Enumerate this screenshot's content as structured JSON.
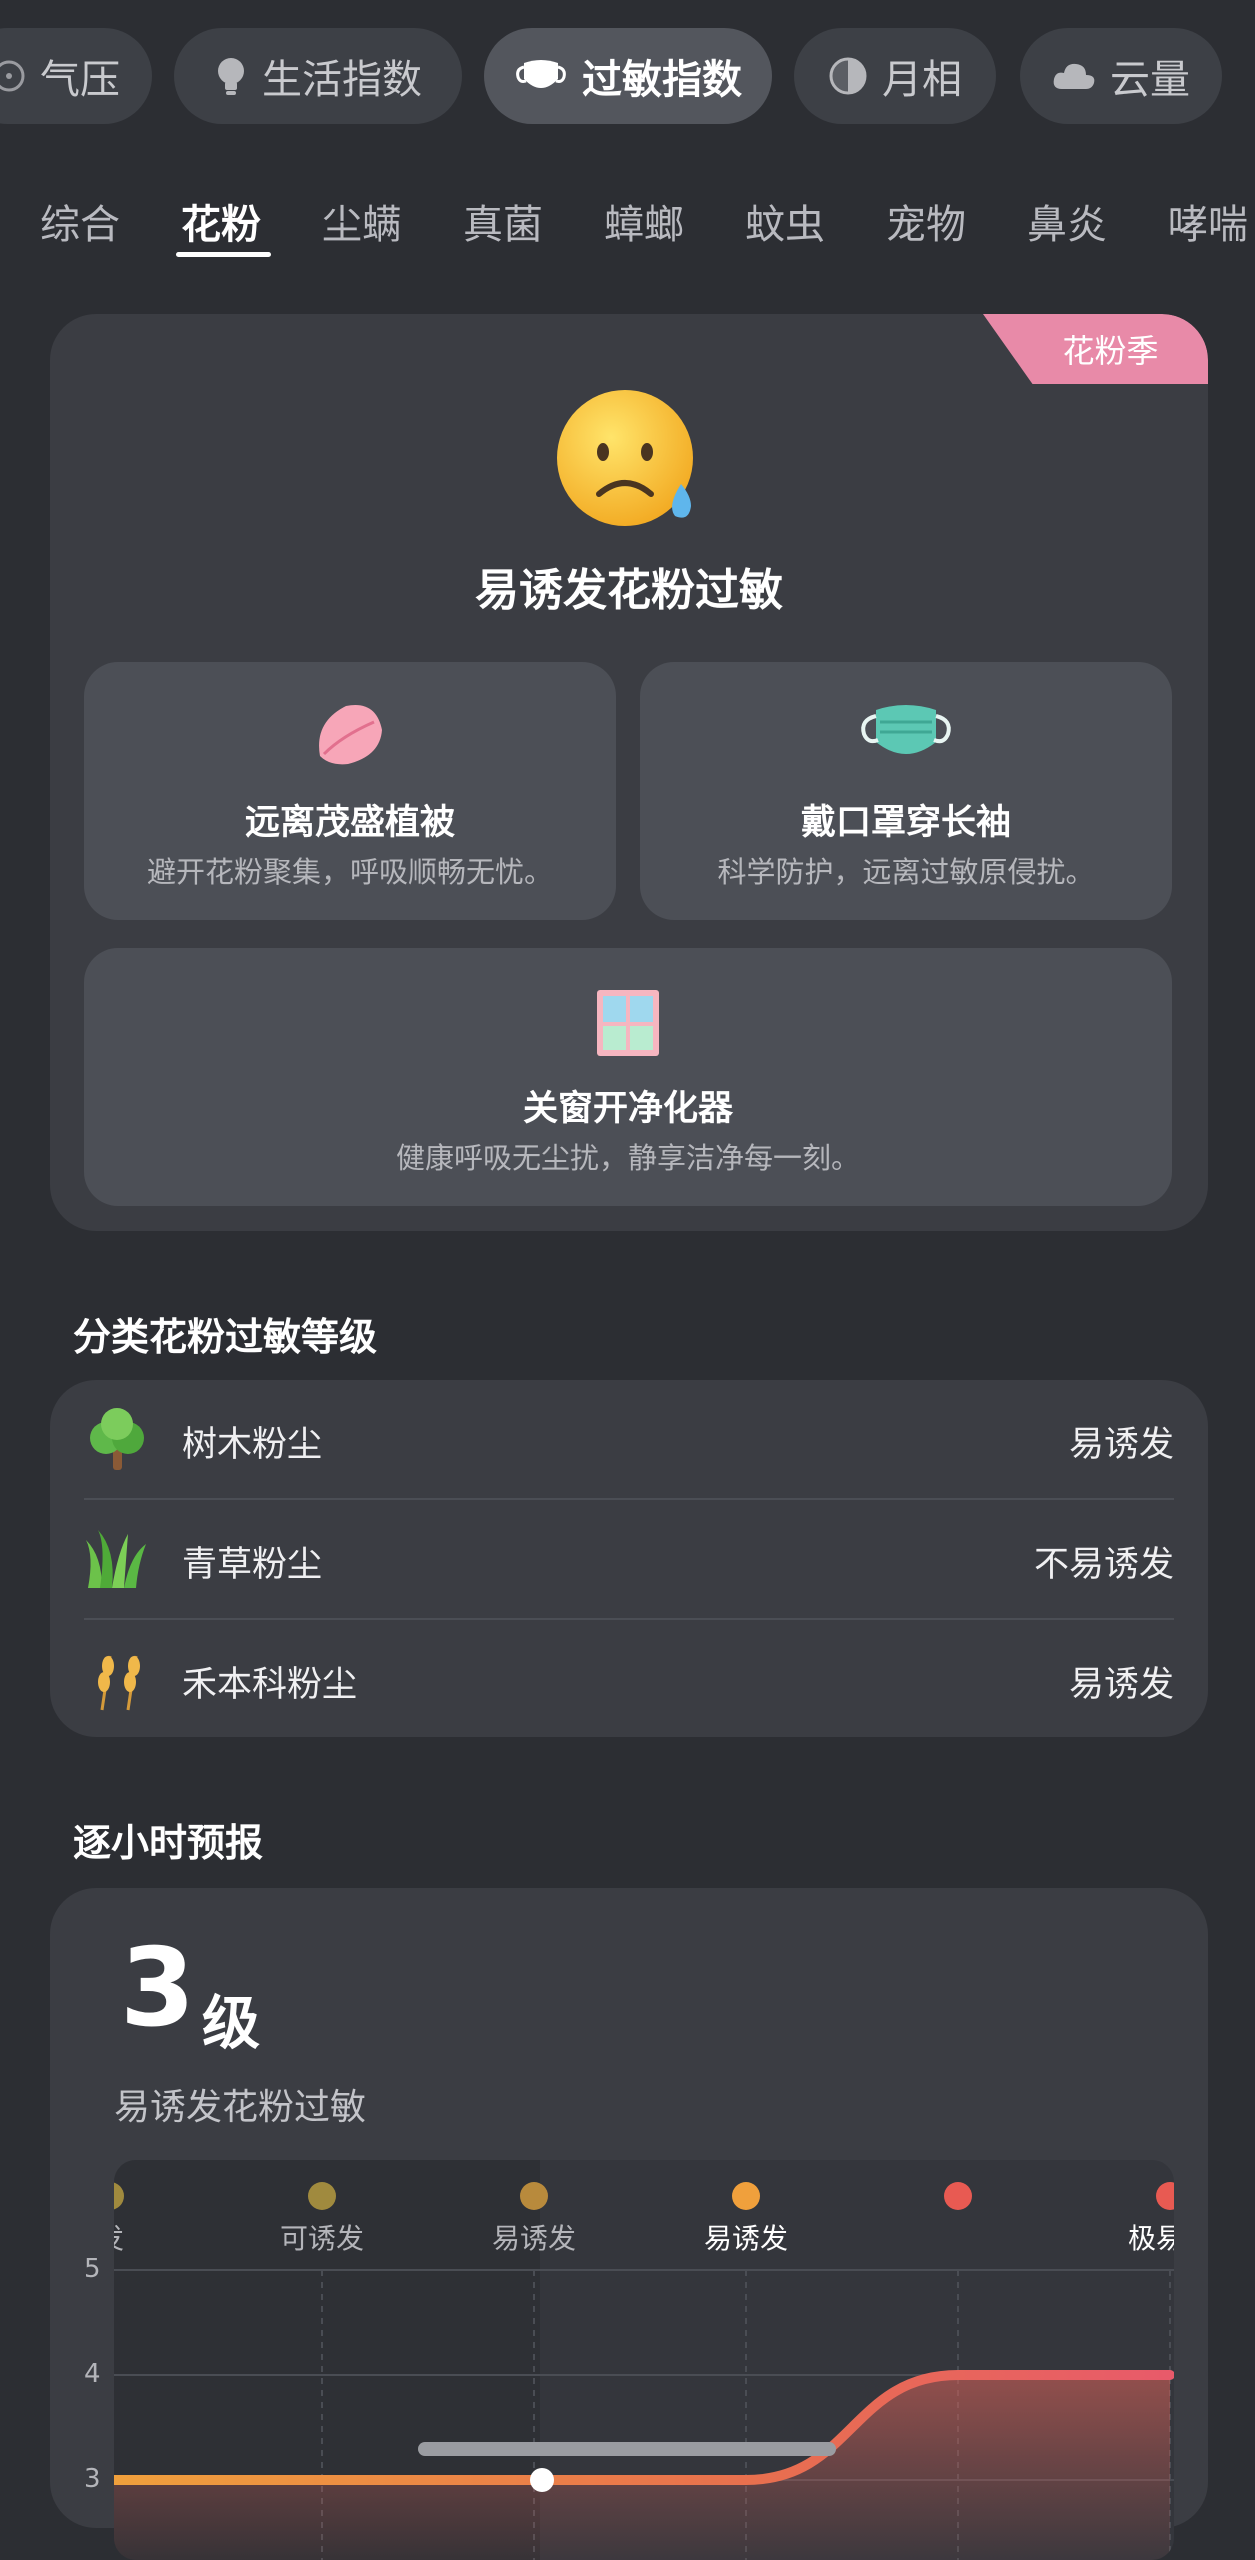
{
  "top_tabs": [
    {
      "label": "气压",
      "icon": "gauge-icon"
    },
    {
      "label": "生活指数",
      "icon": "lightbulb-icon"
    },
    {
      "label": "过敏指数",
      "icon": "mask-icon",
      "active": true
    },
    {
      "label": "月相",
      "icon": "moon-icon"
    },
    {
      "label": "云量",
      "icon": "cloud-icon"
    }
  ],
  "sub_tabs": [
    "综合",
    "花粉",
    "尘螨",
    "真菌",
    "蟑螂",
    "蚊虫",
    "宠物",
    "鼻炎",
    "哮喘"
  ],
  "active_sub_tab": "花粉",
  "hero": {
    "season_tag": "花粉季",
    "face_icon": "sad-face-tear-icon",
    "title": "易诱发花粉过敏",
    "tips": [
      {
        "title": "远离茂盛植被",
        "desc": "避开花粉聚集，呼吸顺畅无忧。",
        "icon": "petal-icon"
      },
      {
        "title": "戴口罩穿长袖",
        "desc": "科学防护，远离过敏原侵扰。",
        "icon": "face-mask-icon"
      },
      {
        "title": "关窗开净化器",
        "desc": "健康呼吸无尘扰，静享洁净每一刻。",
        "icon": "window-icon"
      }
    ]
  },
  "levels": {
    "title": "分类花粉过敏等级",
    "items": [
      {
        "name": "树木粉尘",
        "value": "易诱发",
        "icon": "tree-icon"
      },
      {
        "name": "青草粉尘",
        "value": "不易诱发",
        "icon": "grass-icon"
      },
      {
        "name": "禾本科粉尘",
        "value": "易诱发",
        "icon": "wheat-icon"
      }
    ]
  },
  "hourly": {
    "title": "逐小时预报",
    "level_number": "3",
    "level_unit": "级",
    "desc": "易诱发花粉过敏",
    "colors": {
      "low": "#a08a3e",
      "mid": "#b88a3c",
      "high": "#f0a03c",
      "red": "#e85a52"
    }
  },
  "chart_data": {
    "type": "area",
    "categories": [
      "发",
      "可诱发",
      "易诱发",
      "易诱发",
      "",
      "极易诱"
    ],
    "y_ticks": [
      "5",
      "4",
      "3"
    ],
    "ylim": [
      3,
      5
    ],
    "values": [
      3,
      3,
      3,
      3,
      4,
      4
    ],
    "highlight_index": 3,
    "grid": true
  }
}
